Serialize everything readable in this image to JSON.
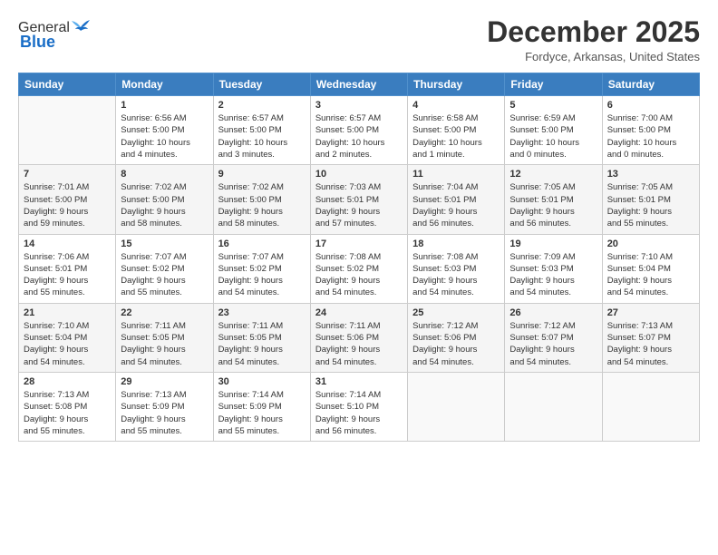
{
  "logo": {
    "general": "General",
    "blue": "Blue"
  },
  "header": {
    "month": "December 2025",
    "location": "Fordyce, Arkansas, United States"
  },
  "days_of_week": [
    "Sunday",
    "Monday",
    "Tuesday",
    "Wednesday",
    "Thursday",
    "Friday",
    "Saturday"
  ],
  "weeks": [
    [
      {
        "day": "",
        "info": ""
      },
      {
        "day": "1",
        "info": "Sunrise: 6:56 AM\nSunset: 5:00 PM\nDaylight: 10 hours\nand 4 minutes."
      },
      {
        "day": "2",
        "info": "Sunrise: 6:57 AM\nSunset: 5:00 PM\nDaylight: 10 hours\nand 3 minutes."
      },
      {
        "day": "3",
        "info": "Sunrise: 6:57 AM\nSunset: 5:00 PM\nDaylight: 10 hours\nand 2 minutes."
      },
      {
        "day": "4",
        "info": "Sunrise: 6:58 AM\nSunset: 5:00 PM\nDaylight: 10 hours\nand 1 minute."
      },
      {
        "day": "5",
        "info": "Sunrise: 6:59 AM\nSunset: 5:00 PM\nDaylight: 10 hours\nand 0 minutes."
      },
      {
        "day": "6",
        "info": "Sunrise: 7:00 AM\nSunset: 5:00 PM\nDaylight: 10 hours\nand 0 minutes."
      }
    ],
    [
      {
        "day": "7",
        "info": "Sunrise: 7:01 AM\nSunset: 5:00 PM\nDaylight: 9 hours\nand 59 minutes."
      },
      {
        "day": "8",
        "info": "Sunrise: 7:02 AM\nSunset: 5:00 PM\nDaylight: 9 hours\nand 58 minutes."
      },
      {
        "day": "9",
        "info": "Sunrise: 7:02 AM\nSunset: 5:00 PM\nDaylight: 9 hours\nand 58 minutes."
      },
      {
        "day": "10",
        "info": "Sunrise: 7:03 AM\nSunset: 5:01 PM\nDaylight: 9 hours\nand 57 minutes."
      },
      {
        "day": "11",
        "info": "Sunrise: 7:04 AM\nSunset: 5:01 PM\nDaylight: 9 hours\nand 56 minutes."
      },
      {
        "day": "12",
        "info": "Sunrise: 7:05 AM\nSunset: 5:01 PM\nDaylight: 9 hours\nand 56 minutes."
      },
      {
        "day": "13",
        "info": "Sunrise: 7:05 AM\nSunset: 5:01 PM\nDaylight: 9 hours\nand 55 minutes."
      }
    ],
    [
      {
        "day": "14",
        "info": "Sunrise: 7:06 AM\nSunset: 5:01 PM\nDaylight: 9 hours\nand 55 minutes."
      },
      {
        "day": "15",
        "info": "Sunrise: 7:07 AM\nSunset: 5:02 PM\nDaylight: 9 hours\nand 55 minutes."
      },
      {
        "day": "16",
        "info": "Sunrise: 7:07 AM\nSunset: 5:02 PM\nDaylight: 9 hours\nand 54 minutes."
      },
      {
        "day": "17",
        "info": "Sunrise: 7:08 AM\nSunset: 5:02 PM\nDaylight: 9 hours\nand 54 minutes."
      },
      {
        "day": "18",
        "info": "Sunrise: 7:08 AM\nSunset: 5:03 PM\nDaylight: 9 hours\nand 54 minutes."
      },
      {
        "day": "19",
        "info": "Sunrise: 7:09 AM\nSunset: 5:03 PM\nDaylight: 9 hours\nand 54 minutes."
      },
      {
        "day": "20",
        "info": "Sunrise: 7:10 AM\nSunset: 5:04 PM\nDaylight: 9 hours\nand 54 minutes."
      }
    ],
    [
      {
        "day": "21",
        "info": "Sunrise: 7:10 AM\nSunset: 5:04 PM\nDaylight: 9 hours\nand 54 minutes."
      },
      {
        "day": "22",
        "info": "Sunrise: 7:11 AM\nSunset: 5:05 PM\nDaylight: 9 hours\nand 54 minutes."
      },
      {
        "day": "23",
        "info": "Sunrise: 7:11 AM\nSunset: 5:05 PM\nDaylight: 9 hours\nand 54 minutes."
      },
      {
        "day": "24",
        "info": "Sunrise: 7:11 AM\nSunset: 5:06 PM\nDaylight: 9 hours\nand 54 minutes."
      },
      {
        "day": "25",
        "info": "Sunrise: 7:12 AM\nSunset: 5:06 PM\nDaylight: 9 hours\nand 54 minutes."
      },
      {
        "day": "26",
        "info": "Sunrise: 7:12 AM\nSunset: 5:07 PM\nDaylight: 9 hours\nand 54 minutes."
      },
      {
        "day": "27",
        "info": "Sunrise: 7:13 AM\nSunset: 5:07 PM\nDaylight: 9 hours\nand 54 minutes."
      }
    ],
    [
      {
        "day": "28",
        "info": "Sunrise: 7:13 AM\nSunset: 5:08 PM\nDaylight: 9 hours\nand 55 minutes."
      },
      {
        "day": "29",
        "info": "Sunrise: 7:13 AM\nSunset: 5:09 PM\nDaylight: 9 hours\nand 55 minutes."
      },
      {
        "day": "30",
        "info": "Sunrise: 7:14 AM\nSunset: 5:09 PM\nDaylight: 9 hours\nand 55 minutes."
      },
      {
        "day": "31",
        "info": "Sunrise: 7:14 AM\nSunset: 5:10 PM\nDaylight: 9 hours\nand 56 minutes."
      },
      {
        "day": "",
        "info": ""
      },
      {
        "day": "",
        "info": ""
      },
      {
        "day": "",
        "info": ""
      }
    ]
  ]
}
